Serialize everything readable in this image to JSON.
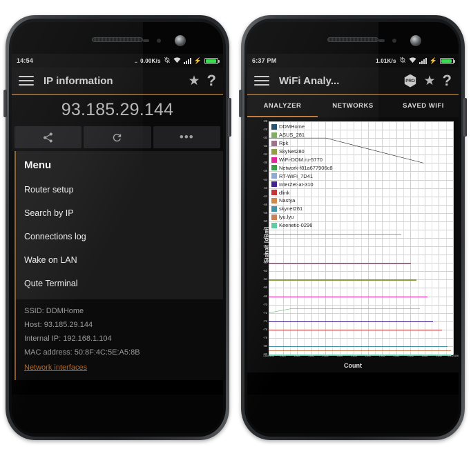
{
  "left_phone": {
    "status_bar": {
      "time": "14:54",
      "network_rate": "0.00K/s",
      "dots": "...",
      "icons": [
        "sync-disabled-icon",
        "wifi-icon",
        "signal-bars-icon",
        "charging-bolt-icon",
        "battery-icon"
      ]
    },
    "action_bar": {
      "menu_icon": "hamburger-menu-icon",
      "title": "IP information",
      "star_icon": "star-icon",
      "help_icon": "question-mark-icon"
    },
    "ip_address": "93.185.29.144",
    "buttons": [
      {
        "name": "share-button",
        "icon": "share-icon"
      },
      {
        "name": "refresh-button",
        "icon": "refresh-icon"
      },
      {
        "name": "more-button",
        "icon": "overflow-dots-icon"
      }
    ],
    "menu": {
      "title": "Menu",
      "items": [
        "Router setup",
        "Search by IP",
        "Connections log",
        "Wake on LAN",
        "Qute Terminal"
      ]
    },
    "info": {
      "ssid": "SSID: DDMHome",
      "host": "Host: 93.185.29.144",
      "internal_ip": "Internal IP: 192.168.1.104",
      "mac": "MAC address: 50:8F:4C:5E:A5:8B",
      "link": "Network interfaces"
    }
  },
  "right_phone": {
    "status_bar": {
      "time": "6:37 PM",
      "network_rate": "1.01K/s",
      "icons": [
        "sync-disabled-icon",
        "wifi-icon",
        "signal-bars-icon",
        "charging-bolt-icon",
        "battery-icon"
      ]
    },
    "action_bar": {
      "menu_icon": "hamburger-menu-icon",
      "title": "WiFi Analy...",
      "pro_badge": "PRO",
      "star_icon": "star-icon",
      "help_icon": "question-mark-icon"
    },
    "tabs": [
      {
        "label": "ANALYZER",
        "active": true
      },
      {
        "label": "NETWORKS",
        "active": false
      },
      {
        "label": "SAVED WIFI",
        "active": false
      }
    ]
  },
  "chart_data": {
    "type": "line",
    "title": "",
    "xlabel": "Count",
    "ylabel": "Signal: [dBm]",
    "ylim": [
      -82,
      -26
    ],
    "ytick_step": 2,
    "yticks": [
      -26,
      -28,
      -30,
      -32,
      -34,
      -36,
      -38,
      -40,
      -42,
      -44,
      -46,
      -48,
      -50,
      -52,
      -54,
      -56,
      -58,
      -60,
      -62,
      -64,
      -66,
      -68,
      -70,
      -72,
      -74,
      -76,
      -78,
      -80,
      -82
    ],
    "xticks": [
      "1,814,816",
      "1,820",
      "1,826",
      "1,832",
      "1,834",
      "1,836",
      "1,838",
      "1,840",
      "1,842",
      "1,844",
      "1,846",
      "1,848",
      "1,840",
      "1,842,846"
    ],
    "grid": true,
    "legend_position": "top-left",
    "series": [
      {
        "name": "DDMHome",
        "color": "#1b4a6b",
        "level": -30,
        "end_frac": 0.84,
        "slope_to": -36
      },
      {
        "name": "ASUS_281",
        "color": "#7aaa5a",
        "level": -53,
        "end_frac": 0.72
      },
      {
        "name": "Rpk",
        "color": "#9a6b85",
        "level": -60,
        "end_frac": 0.77
      },
      {
        "name": "SkyNet280",
        "color": "#8c9a3a",
        "level": -64,
        "end_frac": 0.8
      },
      {
        "name": "WiFi-DOM.ru-5770",
        "color": "#e0189a",
        "level": -68,
        "end_frac": 0.86
      },
      {
        "name": "Network-f81a677906c8",
        "color": "#2f9b3f",
        "level": -72,
        "end_frac": 0.82,
        "slope_to": -71
      },
      {
        "name": "RT-WiFi_7D41",
        "color": "#8aa6cf",
        "level": -74,
        "end_frac": 0.89
      },
      {
        "name": "InterZet-at-310",
        "color": "#3a1b8c",
        "level": -74,
        "end_frac": 0.89
      },
      {
        "name": "dlink",
        "color": "#c22b2b",
        "level": -76,
        "end_frac": 0.94
      },
      {
        "name": "Nastya",
        "color": "#cf8242",
        "level": -80,
        "end_frac": 0.97
      },
      {
        "name": "skynet261",
        "color": "#3b8fa3",
        "level": -80,
        "end_frac": 0.97
      },
      {
        "name": "lyu.lyu",
        "color": "#c97b4f",
        "level": -81,
        "end_frac": 0.99
      },
      {
        "name": "Keenetic-0296",
        "color": "#5cc9a0",
        "level": -82,
        "end_frac": 0.99
      }
    ]
  }
}
